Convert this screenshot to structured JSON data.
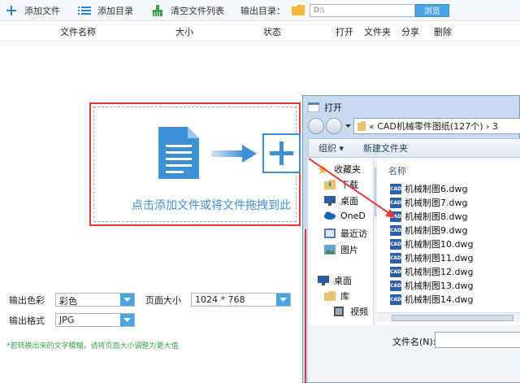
{
  "toolbar": {
    "add_file": "添加文件",
    "add_folder": "添加目录",
    "clear_list": "清空文件列表",
    "output_dir_label": "输出目录：",
    "output_dir_value": "D:\\",
    "browse": "浏览"
  },
  "columns": {
    "name": "文件名称",
    "size": "大小",
    "status": "状态",
    "open": "打开",
    "folder": "文件夹",
    "share": "分享",
    "delete": "删除"
  },
  "drop_area": {
    "text": "点击添加文件或将文件拖拽到此"
  },
  "options": {
    "color_label": "输出色彩",
    "color_value": "彩色",
    "page_size_label": "页面大小",
    "page_size_value": "1024 * 768",
    "format_label": "输出格式",
    "format_value": "JPG"
  },
  "hint": "*若转换出来的文字模糊，请将页面大小调整为更大值",
  "dialog": {
    "title": "打开",
    "breadcrumb": "«  CAD机械零件图纸(127个)  ›  3",
    "organize": "组织 ▾",
    "new_folder": "新建文件夹",
    "column_name": "名称",
    "nav_items": [
      {
        "label": "收藏夹",
        "icon": "star-icon"
      },
      {
        "label": "下载",
        "icon": "download-folder-icon"
      },
      {
        "label": "桌面",
        "icon": "desktop-icon"
      },
      {
        "label": "OneD",
        "icon": "onedrive-icon"
      },
      {
        "label": "最近访",
        "icon": "recent-icon"
      },
      {
        "label": "图片",
        "icon": "pictures-icon"
      },
      {
        "label": "桌面",
        "icon": "desktop-icon"
      },
      {
        "label": "库",
        "icon": "library-icon"
      },
      {
        "label": "视频",
        "icon": "video-icon"
      }
    ],
    "files": [
      "机械制图6.dwg",
      "机械制图7.dwg",
      "机械制图8.dwg",
      "机械制图9.dwg",
      "机械制图10.dwg",
      "机械制图11.dwg",
      "机械制图12.dwg",
      "机械制图13.dwg",
      "机械制图14.dwg"
    ],
    "file_icon_text": "CAD",
    "filename_label": "文件名(N):"
  },
  "colors": {
    "accent": "#4aa3e6",
    "highlight_border": "#e03a3a",
    "hint_green": "#3aa34a"
  }
}
